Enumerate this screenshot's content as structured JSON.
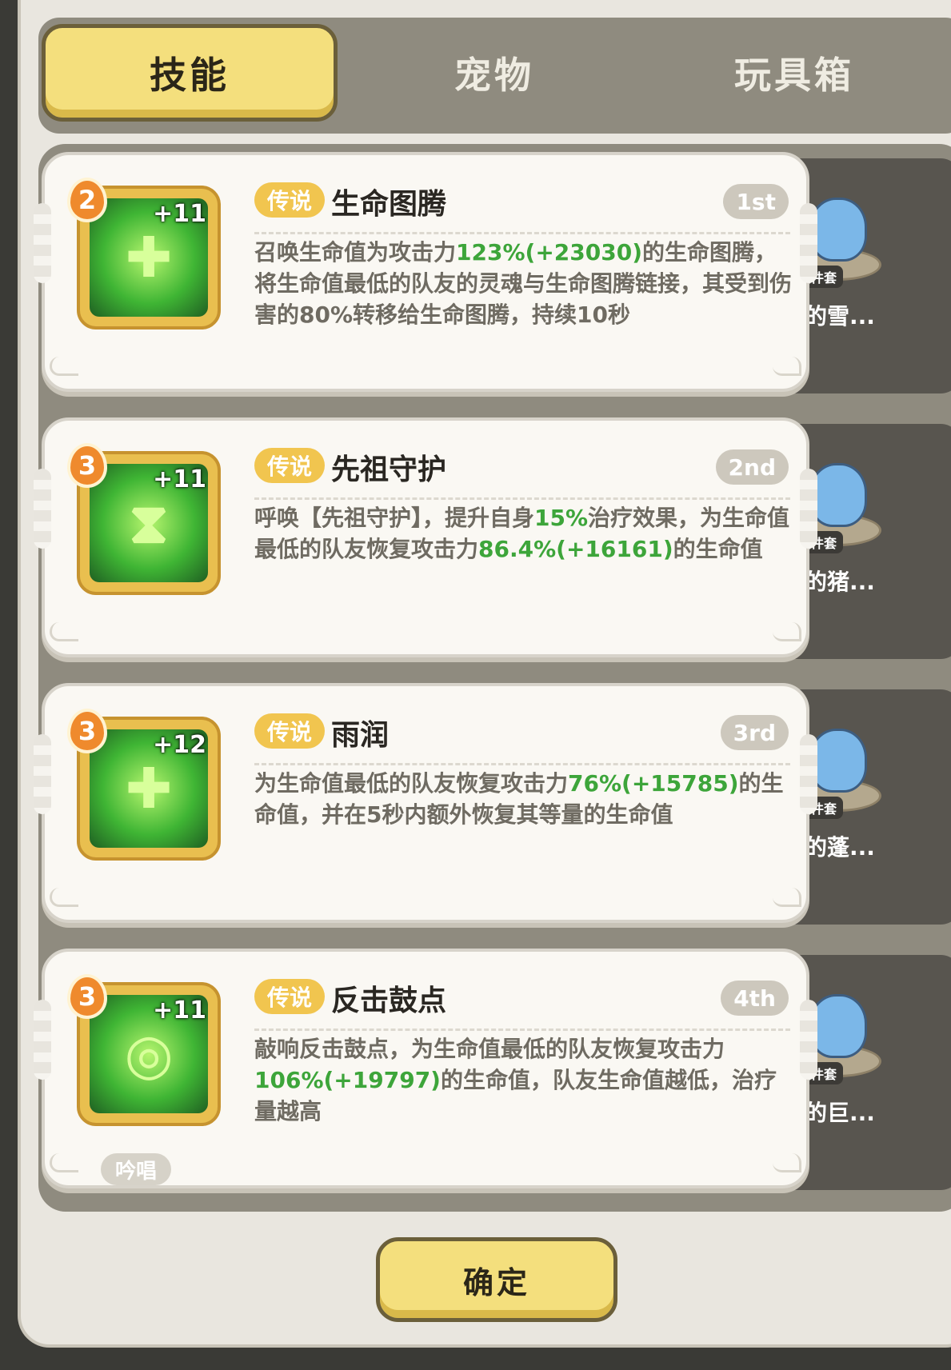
{
  "tabs": [
    {
      "label": "技能",
      "active": true
    },
    {
      "label": "宠物",
      "active": false
    },
    {
      "label": "玩具箱",
      "active": false
    }
  ],
  "skills": [
    {
      "level": "2",
      "plus": "+11",
      "rarity": "传说",
      "name": "生命图腾",
      "rank": "1st",
      "desc": [
        {
          "t": "召唤生命值为攻击力",
          "g": false
        },
        {
          "t": "123%(+23030)",
          "g": true
        },
        {
          "t": "的生命图腾，将生命值最低的队友的灵魂与生命图腾链接，其受到伤害的80%转移给生命图腾，持续10秒",
          "g": false
        }
      ],
      "pet_tag": "六件套",
      "pet_name": "快乐的雪...",
      "icon_glyph": "✚",
      "cast_tag": ""
    },
    {
      "level": "3",
      "plus": "+11",
      "rarity": "传说",
      "name": "先祖守护",
      "rank": "2nd",
      "desc": [
        {
          "t": "呼唤【先祖守护】，提升自身",
          "g": false
        },
        {
          "t": "15%",
          "g": true
        },
        {
          "t": "治疗效果，为生命值最低的队友恢复攻击力",
          "g": false
        },
        {
          "t": "86.4%(+16161)",
          "g": true
        },
        {
          "t": "的生命值",
          "g": false
        }
      ],
      "pet_tag": "六件套",
      "pet_name": "活跃的猪...",
      "icon_glyph": "⧗",
      "cast_tag": ""
    },
    {
      "level": "3",
      "plus": "+12",
      "rarity": "传说",
      "name": "雨润",
      "rank": "3rd",
      "desc": [
        {
          "t": "为生命值最低的队友恢复攻击力",
          "g": false
        },
        {
          "t": "76%(+15785)",
          "g": true
        },
        {
          "t": "的生命值，并在5秒内额外恢复其等量的生命值",
          "g": false
        }
      ],
      "pet_tag": "六件套",
      "pet_name": "发呆的蓬...",
      "icon_glyph": "✚",
      "cast_tag": ""
    },
    {
      "level": "3",
      "plus": "+11",
      "rarity": "传说",
      "name": "反击鼓点",
      "rank": "4th",
      "desc": [
        {
          "t": "敲响反击鼓点，为生命值最低的队友恢复攻击力",
          "g": false
        },
        {
          "t": "106%(+19797)",
          "g": true
        },
        {
          "t": "的生命值，队友生命值越低，治疗量越高",
          "g": false
        }
      ],
      "pet_tag": "六件套",
      "pet_name": "友好的巨...",
      "icon_glyph": "◎",
      "cast_tag": "吟唱"
    }
  ],
  "confirm_label": "确定",
  "colors": {
    "accent_yellow": "#f4df7d",
    "highlight_green": "#3da53a",
    "rarity_gold": "#f1c54f"
  }
}
